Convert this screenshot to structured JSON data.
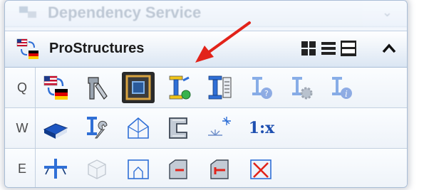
{
  "previous_panel": {
    "title": "Dependency Service"
  },
  "panel": {
    "title": "ProStructures"
  },
  "rows": [
    {
      "key": "Q"
    },
    {
      "key": "W",
      "scale_label": "1:x"
    },
    {
      "key": "E"
    }
  ],
  "colors": {
    "arrow": "#e2231a",
    "accent": "#2f6fd6",
    "panel_border": "#a9bdd6"
  }
}
